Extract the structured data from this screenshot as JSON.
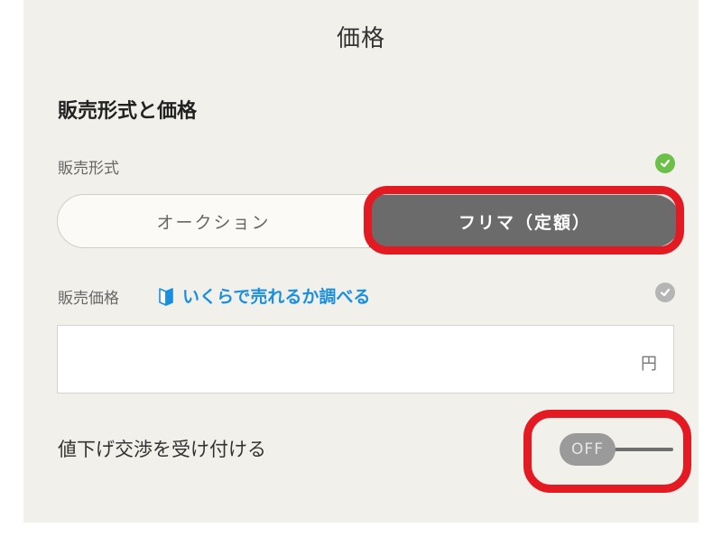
{
  "header": {
    "title": "価格"
  },
  "section": {
    "heading": "販売形式と価格"
  },
  "sale_format": {
    "label": "販売形式",
    "options": [
      "オークション",
      "フリマ（定額）"
    ],
    "selected": "フリマ（定額）"
  },
  "sale_price": {
    "label": "販売価格",
    "guide_link": "いくらで売れるか調べる",
    "value": "",
    "unit": "円"
  },
  "negotiation": {
    "label": "値下げ交渉を受け付ける",
    "toggle_state": "OFF"
  },
  "colors": {
    "accent_red": "#e41a22",
    "check_green": "#6cc04a",
    "check_gray": "#b5b5b5",
    "link_blue": "#1a8fe0"
  }
}
